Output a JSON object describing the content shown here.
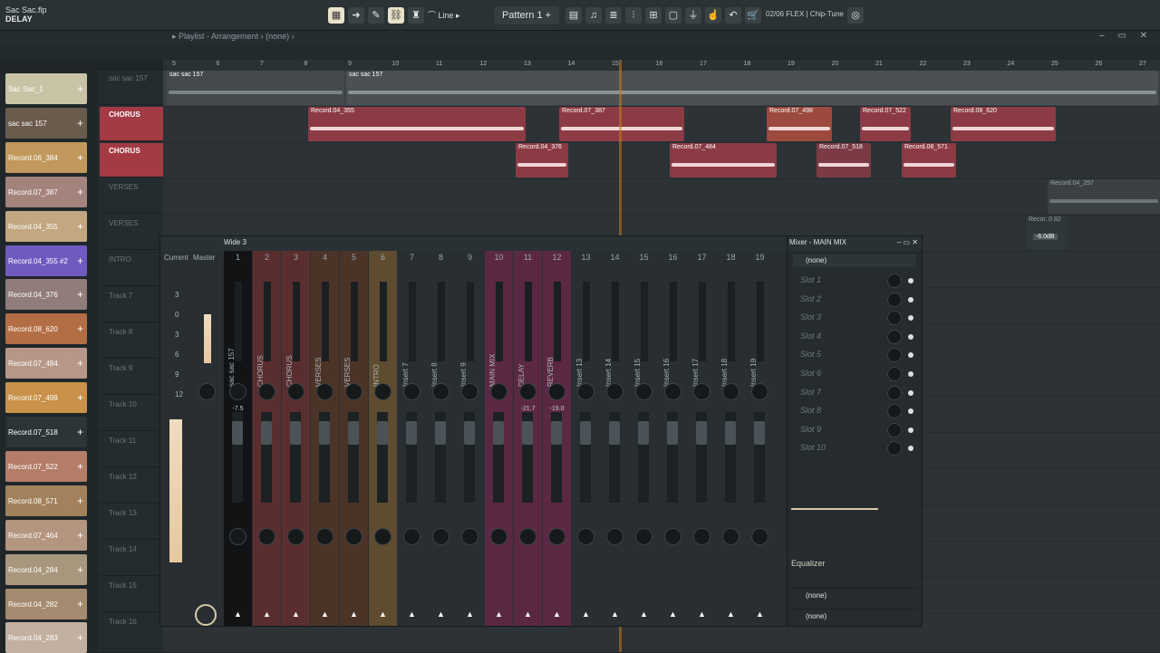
{
  "project": {
    "file": "Sac Sac.flp",
    "subtitle": "DELAY"
  },
  "toolbar": {
    "snap": "Line",
    "pattern": "Pattern 1",
    "cpu": "02/06",
    "hint": "FLEX | Chip-Tune"
  },
  "playlist": {
    "title": "Playlist - Arrangement",
    "selection": "(none)",
    "window_controls": "– ▭ ✕"
  },
  "ruler": {
    "bars": [
      "5",
      "6",
      "7",
      "8",
      "9",
      "10",
      "11",
      "12",
      "13",
      "14",
      "15",
      "16",
      "17",
      "18",
      "19",
      "20",
      "21",
      "22",
      "23",
      "24",
      "25",
      "26",
      "27"
    ]
  },
  "sidebar": {
    "clips": [
      {
        "label": "Sac Sac_1",
        "color": "#c9c3a6"
      },
      {
        "label": "sac sac 157",
        "color": "#6a5b4d"
      },
      {
        "label": "Record.06_384",
        "color": "#c1995c"
      },
      {
        "label": "Record.07_387",
        "color": "#a5837d"
      },
      {
        "label": "Record.04_355",
        "color": "#c2a780"
      },
      {
        "label": "Record.04_355 #2",
        "color": "#6f5ac0"
      },
      {
        "label": "Record.04_376",
        "color": "#907c79"
      },
      {
        "label": "Record.08_620",
        "color": "#b46e45"
      },
      {
        "label": "Record.07_484",
        "color": "#b79888"
      },
      {
        "label": "Record.07_498",
        "color": "#c9914a"
      },
      {
        "label": "Record.07_518",
        "color": "#2d3437"
      },
      {
        "label": "Record.07_522",
        "color": "#b47d68"
      },
      {
        "label": "Record.08_571",
        "color": "#a1825c"
      },
      {
        "label": "Record.07_464",
        "color": "#b49580"
      },
      {
        "label": "Record.04_284",
        "color": "#a8977d"
      },
      {
        "label": "Record.04_282",
        "color": "#a48a6e"
      },
      {
        "label": "Record.04_283",
        "color": "#c2b0a0"
      }
    ]
  },
  "tracks": {
    "headers": [
      {
        "label": "sac sac 157",
        "kind": "plain"
      },
      {
        "label": "CHORUS",
        "kind": "red"
      },
      {
        "label": "CHORUS",
        "kind": "red"
      },
      {
        "label": "VERSES",
        "kind": "plain"
      },
      {
        "label": "VERSES",
        "kind": "plain"
      },
      {
        "label": "INTRO",
        "kind": "plain"
      },
      {
        "label": "Track 7",
        "kind": "plain"
      },
      {
        "label": "Track 8",
        "kind": "plain"
      },
      {
        "label": "Track 9",
        "kind": "plain"
      },
      {
        "label": "Track 10",
        "kind": "plain"
      },
      {
        "label": "Track 11",
        "kind": "plain"
      },
      {
        "label": "Track 12",
        "kind": "plain"
      },
      {
        "label": "Track 13",
        "kind": "plain"
      },
      {
        "label": "Track 14",
        "kind": "plain"
      },
      {
        "label": "Track 15",
        "kind": "plain"
      },
      {
        "label": "Track 16",
        "kind": "plain"
      }
    ]
  },
  "arrangement": {
    "top_clips": [
      "sac sac 157",
      "sac sac 157"
    ],
    "chorus1": [
      "Record.04_355",
      "Record.07_387",
      "Record.07_498",
      "Record.07_522",
      "Record.08_620"
    ],
    "chorus2": [
      "Record.04_376",
      "Record.07_484",
      "Record.07_518",
      "Record.08_571"
    ],
    "extra": [
      "Record.04_297",
      "Recor..0.82",
      "-6.0dB"
    ]
  },
  "mixer": {
    "preset": "Wide 3",
    "current_label": "Current",
    "master_label": "Master",
    "db_scale": [
      "3",
      "0",
      "3",
      "6",
      "9",
      "12"
    ],
    "strips": [
      {
        "num": "1",
        "name": "sac sac 157",
        "color": "#111315",
        "value": "-7.5"
      },
      {
        "num": "2",
        "name": "CHORUS",
        "color": "#5a2e2f",
        "value": ""
      },
      {
        "num": "3",
        "name": "CHORUS",
        "color": "#5a2e2f",
        "value": ""
      },
      {
        "num": "4",
        "name": "VERSES",
        "color": "#4c3328",
        "value": ""
      },
      {
        "num": "5",
        "name": "VERSES",
        "color": "#4c3328",
        "value": ""
      },
      {
        "num": "6",
        "name": "INTRO",
        "color": "#5e4c30",
        "value": ""
      },
      {
        "num": "7",
        "name": "Insert 7",
        "color": "#282e31",
        "value": ""
      },
      {
        "num": "8",
        "name": "Insert 8",
        "color": "#282e31",
        "value": ""
      },
      {
        "num": "9",
        "name": "Insert 9",
        "color": "#282e31",
        "value": ""
      },
      {
        "num": "10",
        "name": "MAIN MIX",
        "color": "#5b2843",
        "value": ""
      },
      {
        "num": "11",
        "name": "DELAY",
        "color": "#5b2843",
        "value": "-21.7"
      },
      {
        "num": "12",
        "name": "REVERB",
        "color": "#5b2843",
        "value": "-19.0"
      },
      {
        "num": "13",
        "name": "Insert 13",
        "color": "#282e31",
        "value": ""
      },
      {
        "num": "14",
        "name": "Insert 14",
        "color": "#282e31",
        "value": ""
      },
      {
        "num": "15",
        "name": "Insert 15",
        "color": "#282e31",
        "value": ""
      },
      {
        "num": "16",
        "name": "Insert 16",
        "color": "#282e31",
        "value": ""
      },
      {
        "num": "17",
        "name": "Insert 17",
        "color": "#282e31",
        "value": ""
      },
      {
        "num": "18",
        "name": "Insert 18",
        "color": "#282e31",
        "value": ""
      },
      {
        "num": "19",
        "name": "Insert 19",
        "color": "#282e31",
        "value": ""
      }
    ]
  },
  "mixer_panel": {
    "title": "Mixer - MAIN MIX",
    "input": "(none)",
    "slots": [
      "Slot 1",
      "Slot 2",
      "Slot 3",
      "Slot 4",
      "Slot 5",
      "Slot 6",
      "Slot 7",
      "Slot 8",
      "Slot 9",
      "Slot 10"
    ],
    "eq_label": "Equalizer",
    "out1": "(none)",
    "out2": "(none)"
  }
}
